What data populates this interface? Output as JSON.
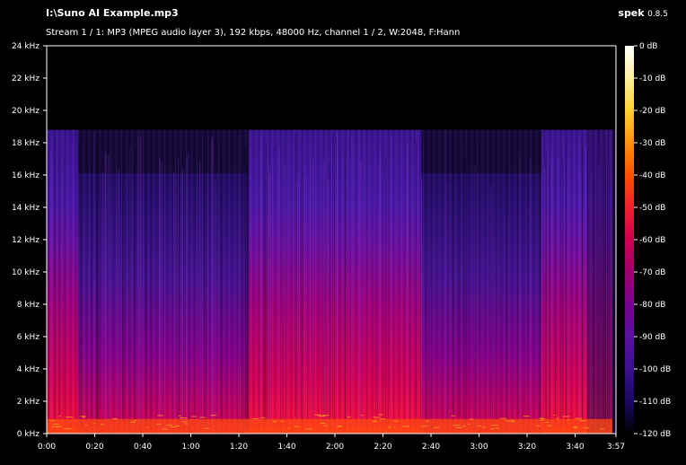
{
  "header": {
    "file_title": "I:\\Suno AI Example.mp3",
    "app_name": "spek",
    "app_version": "0.8.5",
    "stream_info": "Stream 1 / 1: MP3 (MPEG audio layer 3), 192 kbps, 48000 Hz, channel 1 / 2, W:2048, F:Hann"
  },
  "axes": {
    "frequency_ticks": [
      "0 kHz",
      "2 kHz",
      "4 kHz",
      "6 kHz",
      "8 kHz",
      "10 kHz",
      "12 kHz",
      "14 kHz",
      "16 kHz",
      "18 kHz",
      "20 kHz",
      "22 kHz",
      "24 kHz"
    ],
    "time_ticks": [
      "0:00",
      "0:20",
      "0:40",
      "1:00",
      "1:20",
      "1:40",
      "2:00",
      "2:20",
      "2:40",
      "3:00",
      "3:20",
      "3:40",
      "3:57"
    ],
    "db_ticks": [
      "0 dB",
      "-10 dB",
      "-20 dB",
      "-30 dB",
      "-40 dB",
      "-50 dB",
      "-60 dB",
      "-70 dB",
      "-80 dB",
      "-90 dB",
      "-100 dB",
      "-110 dB",
      "-120 dB"
    ]
  },
  "spectrogram": {
    "duration_s": 237,
    "max_freq_khz": 24,
    "cutoff_khz": 18.8,
    "quiet_sections_s": [
      [
        13,
        84
      ],
      [
        156,
        206
      ]
    ]
  },
  "colormap": [
    "#ffffff",
    "#fff0a0",
    "#ffd030",
    "#ff9010",
    "#ff5000",
    "#f02030",
    "#d00050",
    "#a00070",
    "#7a0090",
    "#5a10a0",
    "#3a1090",
    "#1a0860",
    "#000000"
  ]
}
